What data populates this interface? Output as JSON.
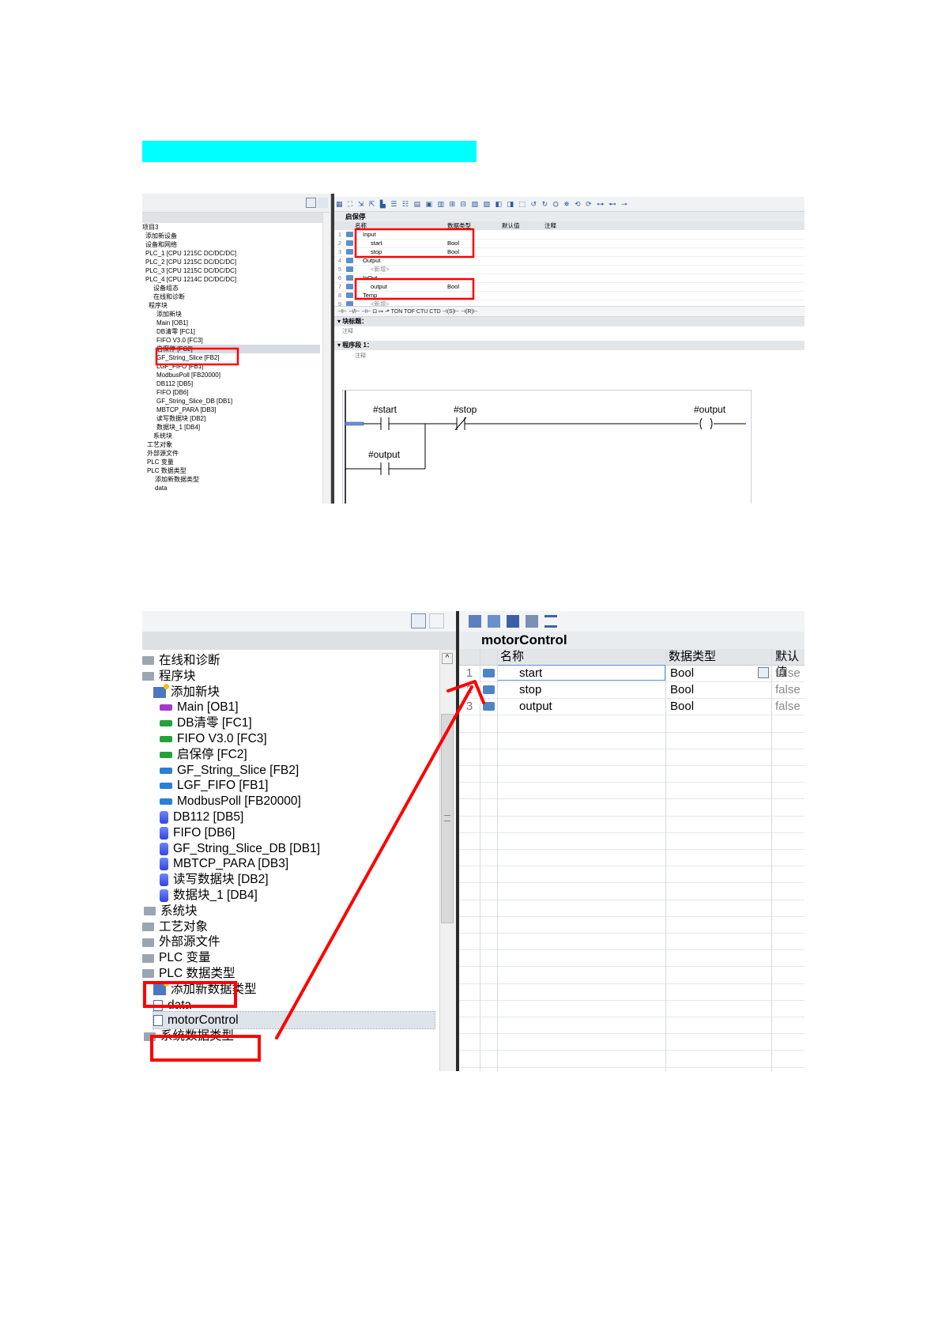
{
  "shot1": {
    "tree": [
      {
        "label": "项目3"
      },
      {
        "label": "添加新设备"
      },
      {
        "label": "设备和网络"
      },
      {
        "label": "PLC_1 [CPU 1215C DC/DC/DC]"
      },
      {
        "label": "PLC_2 [CPU 1215C DC/DC/DC]"
      },
      {
        "label": "PLC_3 [CPU 1215C DC/DC/DC]"
      },
      {
        "label": "PLC_4 [CPU 1214C DC/DC/DC]"
      },
      {
        "label": "设备组态"
      },
      {
        "label": "在线和诊断"
      },
      {
        "label": "程序块"
      },
      {
        "label": "添加新块"
      },
      {
        "label": "Main [OB1]"
      },
      {
        "label": "DB清零 [FC1]"
      },
      {
        "label": "FIFO V3.0 [FC3]"
      },
      {
        "label": "启保停 [FC2]"
      },
      {
        "label": "GF_String_Slice [FB2]"
      },
      {
        "label": "LGF_FIFO [FB1]"
      },
      {
        "label": "ModbusPoll [FB20000]"
      },
      {
        "label": "DB112 [DB5]"
      },
      {
        "label": "FIFO [DB6]"
      },
      {
        "label": "GF_String_Slice_DB [DB1]"
      },
      {
        "label": "MBTCP_PARA [DB3]"
      },
      {
        "label": "读写数据块 [DB2]"
      },
      {
        "label": "数据块_1 [DB4]"
      },
      {
        "label": "系统块"
      },
      {
        "label": "工艺对象"
      },
      {
        "label": "外部源文件"
      },
      {
        "label": "PLC 变量"
      },
      {
        "label": "PLC 数据类型"
      },
      {
        "label": "添加新数据类型"
      },
      {
        "label": "data"
      }
    ],
    "block_title": "启保停",
    "columns": {
      "name": "名称",
      "type": "数据类型",
      "default": "默认值",
      "comment": "注释"
    },
    "rows": [
      {
        "n": "1",
        "name": "Input",
        "type": ""
      },
      {
        "n": "2",
        "name": "start",
        "type": "Bool"
      },
      {
        "n": "3",
        "name": "stop",
        "type": "Bool"
      },
      {
        "n": "4",
        "name": "Output",
        "type": ""
      },
      {
        "n": "5",
        "name": "<新增>",
        "type": ""
      },
      {
        "n": "6",
        "name": "InOut",
        "type": ""
      },
      {
        "n": "7",
        "name": "output",
        "type": "Bool"
      },
      {
        "n": "8",
        "name": "Temp",
        "type": ""
      },
      {
        "n": "9",
        "name": "<新增>",
        "type": ""
      }
    ],
    "instructions": "⊣⊢  ⊣/⊢  ⊣⊢  ⊡  ↦  ⬏  TON  TOF  CTU  CTD  ⊣(S)⊢  ⊣(R)⊢",
    "block_header": "块标题：",
    "block_comment": "注释",
    "network_title": "程序段 1：",
    "network_comment": "注释",
    "ladder": {
      "contact1": "#start",
      "contact2": "#stop",
      "coil": "#output",
      "hold_contact": "#output"
    }
  },
  "shot2": {
    "tree": [
      {
        "label": "在线和诊断",
        "icon": "diag-icon"
      },
      {
        "label": "程序块",
        "icon": "folder-icon"
      },
      {
        "label": "添加新块",
        "icon": "add-block-icon"
      },
      {
        "label": "Main [OB1]",
        "icon": "ob-icon"
      },
      {
        "label": "DB清零 [FC1]",
        "icon": "fc-icon"
      },
      {
        "label": "FIFO V3.0 [FC3]",
        "icon": "fc-icon"
      },
      {
        "label": "启保停 [FC2]",
        "icon": "fc-icon"
      },
      {
        "label": "GF_String_Slice [FB2]",
        "icon": "fb-icon"
      },
      {
        "label": "LGF_FIFO [FB1]",
        "icon": "fb-icon"
      },
      {
        "label": "ModbusPoll [FB20000]",
        "icon": "fb-icon"
      },
      {
        "label": "DB112 [DB5]",
        "icon": "db-icon"
      },
      {
        "label": "FIFO [DB6]",
        "icon": "db-icon"
      },
      {
        "label": "GF_String_Slice_DB [DB1]",
        "icon": "db-icon"
      },
      {
        "label": "MBTCP_PARA [DB3]",
        "icon": "db-icon"
      },
      {
        "label": "读写数据块 [DB2]",
        "icon": "db-icon"
      },
      {
        "label": "数据块_1 [DB4]",
        "icon": "db-icon"
      },
      {
        "label": "系统块",
        "icon": "folder-icon"
      },
      {
        "label": "工艺对象",
        "icon": "folder-icon"
      },
      {
        "label": "外部源文件",
        "icon": "folder-icon"
      },
      {
        "label": "PLC 变量",
        "icon": "folder-icon"
      },
      {
        "label": "PLC 数据类型",
        "icon": "folder-icon"
      },
      {
        "label": "添加新数据类型",
        "icon": "add-block-icon"
      },
      {
        "label": "data",
        "icon": "udt-icon"
      },
      {
        "label": "motorControl",
        "icon": "udt-icon"
      },
      {
        "label": "系统数据类型",
        "icon": "folder-icon"
      }
    ],
    "block_title": "motorControl",
    "columns": {
      "name": "名称",
      "type": "数据类型",
      "default": "默认值"
    },
    "rows": [
      {
        "n": "1",
        "name": "start",
        "type": "Bool",
        "default": "false"
      },
      {
        "n": "2",
        "name": "stop",
        "type": "Bool",
        "default": "false"
      },
      {
        "n": "3",
        "name": "output",
        "type": "Bool",
        "default": "false"
      }
    ]
  },
  "colors": {
    "highlight": "#00ffff",
    "annotation_red": "#ff0000"
  }
}
